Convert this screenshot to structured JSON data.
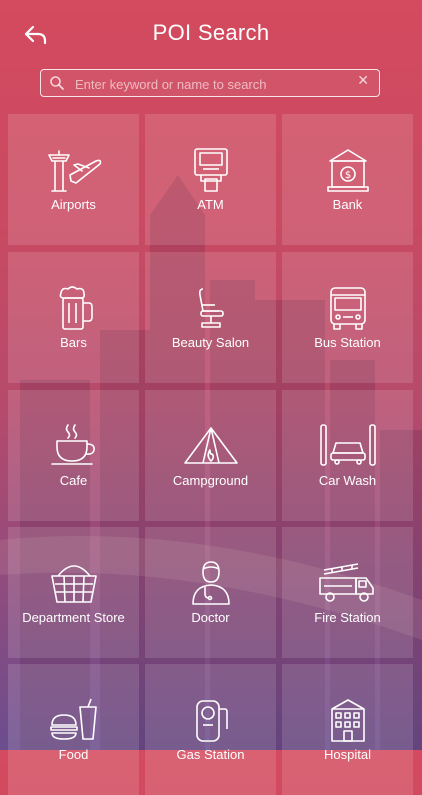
{
  "header": {
    "title": "POI Search",
    "back_icon": "back-arrow-icon"
  },
  "search": {
    "placeholder": "Enter keyword or name to search",
    "value": "",
    "clear_icon": "close-icon"
  },
  "categories": [
    {
      "label": "Airports",
      "icon": "airport-icon"
    },
    {
      "label": "ATM",
      "icon": "atm-icon"
    },
    {
      "label": "Bank",
      "icon": "bank-icon"
    },
    {
      "label": "Bars",
      "icon": "beer-mug-icon"
    },
    {
      "label": "Beauty Salon",
      "icon": "salon-chair-icon"
    },
    {
      "label": "Bus Station",
      "icon": "bus-icon"
    },
    {
      "label": "Cafe",
      "icon": "coffee-cup-icon"
    },
    {
      "label": "Campground",
      "icon": "tent-icon"
    },
    {
      "label": "Car Wash",
      "icon": "car-wash-icon"
    },
    {
      "label": "Department Store",
      "icon": "shopping-basket-icon"
    },
    {
      "label": "Doctor",
      "icon": "doctor-icon"
    },
    {
      "label": "Fire Station",
      "icon": "fire-truck-icon"
    },
    {
      "label": "Food",
      "icon": "fast-food-icon"
    },
    {
      "label": "Gas Station",
      "icon": "gas-pump-icon"
    },
    {
      "label": "Hospital",
      "icon": "hospital-icon"
    }
  ]
}
